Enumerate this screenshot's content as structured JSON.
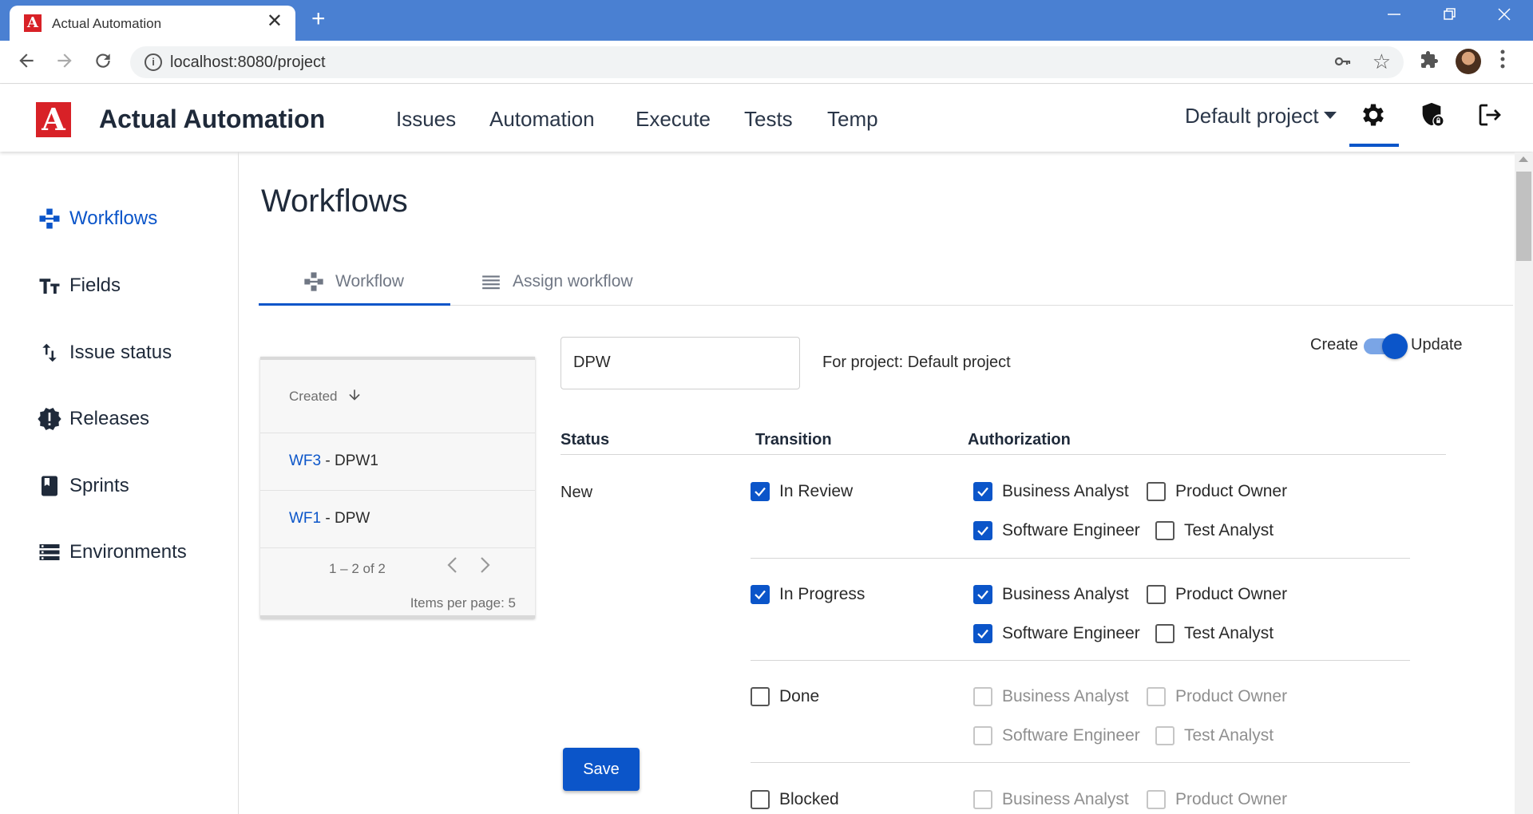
{
  "browser": {
    "tab_title": "Actual Automation",
    "favicon_letter": "A",
    "url": "localhost:8080/project",
    "close_glyph": "✕",
    "new_tab_glyph": "+"
  },
  "header": {
    "logo_letter": "A",
    "brand": "Actual Automation",
    "nav": [
      "Issues",
      "Automation",
      "Execute",
      "Tests",
      "Temp"
    ],
    "project": "Default project",
    "icons": [
      "gear-icon",
      "shield-lock-icon",
      "logout-icon"
    ]
  },
  "sidebar": {
    "items": [
      {
        "label": "Workflows",
        "icon": "workflow-icon",
        "active": true
      },
      {
        "label": "Fields",
        "icon": "text-fields-icon"
      },
      {
        "label": "Issue status",
        "icon": "swap-vert-icon"
      },
      {
        "label": "Releases",
        "icon": "new-releases-icon"
      },
      {
        "label": "Sprints",
        "icon": "book-icon"
      },
      {
        "label": "Environments",
        "icon": "storage-icon"
      }
    ]
  },
  "main": {
    "title": "Workflows",
    "tabs": [
      {
        "label": "Workflow",
        "icon": "workflow-icon"
      },
      {
        "label": "Assign workflow",
        "icon": "list-icon"
      }
    ],
    "list": {
      "sort_label": "Created",
      "rows": [
        {
          "id": "WF3",
          "name": " - DPW1"
        },
        {
          "id": "WF1",
          "name": " - DPW"
        }
      ],
      "range": "1 – 2 of 2",
      "items_per_page": "Items per page:  5"
    },
    "form": {
      "name_value": "DPW",
      "for_project": "For project: Default project",
      "toggle_left": "Create",
      "toggle_right": "Update",
      "toggle_state": "Update",
      "col_status": "Status",
      "col_transition": "Transition",
      "col_authorization": "Authorization",
      "status_value": "New",
      "transitions": [
        {
          "label": "In Review",
          "checked": true,
          "roles": {
            "Business Analyst": true,
            "Product Owner": false,
            "Software Engineer": true,
            "Test Analyst": false
          }
        },
        {
          "label": "In Progress",
          "checked": true,
          "roles": {
            "Business Analyst": true,
            "Product Owner": false,
            "Software Engineer": true,
            "Test Analyst": false
          }
        },
        {
          "label": "Done",
          "checked": false,
          "roles": {
            "Business Analyst": false,
            "Product Owner": false,
            "Software Engineer": false,
            "Test Analyst": false
          }
        },
        {
          "label": "Blocked",
          "checked": false,
          "roles": {
            "Business Analyst": false,
            "Product Owner": false
          }
        }
      ],
      "role_labels": [
        "Business Analyst",
        "Product Owner",
        "Software Engineer",
        "Test Analyst"
      ],
      "save_label": "Save"
    }
  },
  "colors": {
    "accent": "#0b55c9",
    "chrome": "#4a80d2",
    "logo": "#d82127"
  }
}
